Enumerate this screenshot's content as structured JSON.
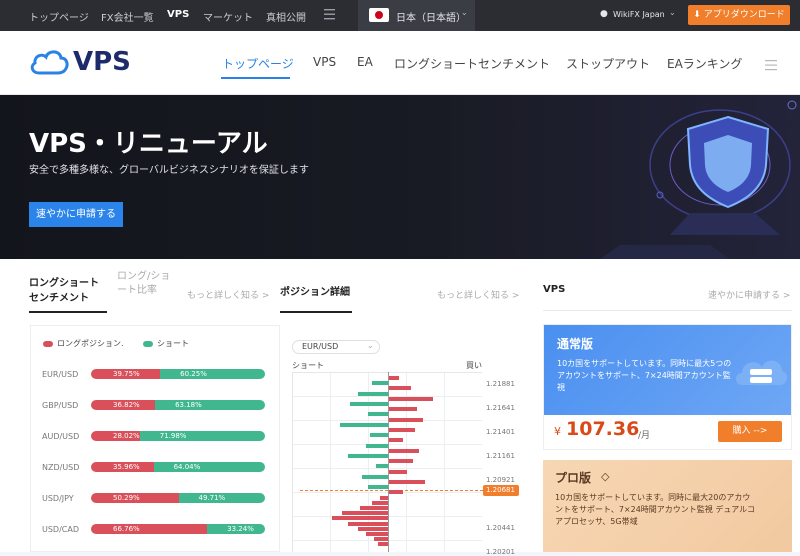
{
  "topbar": {
    "links": [
      "トップページ",
      "FX会社一覧",
      "VPS",
      "マーケット",
      "真相公開"
    ],
    "language": "日本（日本語）",
    "account": "WikiFX Japan",
    "download_label": "アプリダウンロード"
  },
  "nav": {
    "logo": "VPS",
    "items": [
      "トップページ",
      "VPS",
      "EA",
      "ロングショートセンチメント",
      "ストップアウト",
      "EAランキング"
    ]
  },
  "hero": {
    "title": "VPS・リニューアル",
    "subtitle": "安全で多種多様な、グローバルビジネスシナリオを保証します",
    "cta": "速やかに申請する"
  },
  "sentiment": {
    "tab_active": "ロングショートセンチメント",
    "tab_inactive": "ロング/ショート比率",
    "more": "もっと詳しく知る >",
    "legend_long": "ロングポジション.",
    "legend_short": "ショート",
    "rows": [
      {
        "pair": "EUR/USD",
        "long": "39.75%",
        "short": "60.25%"
      },
      {
        "pair": "GBP/USD",
        "long": "36.82%",
        "short": "63.18%"
      },
      {
        "pair": "AUD/USD",
        "long": "28.02%",
        "short": "71.98%"
      },
      {
        "pair": "NZD/USD",
        "long": "35.96%",
        "short": "64.04%"
      },
      {
        "pair": "USD/JPY",
        "long": "50.29%",
        "short": "49.71%"
      },
      {
        "pair": "USD/CAD",
        "long": "66.76%",
        "short": "33.24%"
      }
    ]
  },
  "position": {
    "title": "ポジション詳細",
    "more": "もっと詳しく知る >",
    "select": "EUR/USD",
    "short_label": "ショート",
    "long_label": "買い",
    "prices": [
      "1.21881",
      "1.21641",
      "1.21401",
      "1.21161",
      "1.20921",
      "1.20681",
      "1.20441",
      "1.20201"
    ],
    "current_price": "1.20681"
  },
  "vps": {
    "title": "VPS",
    "more": "速やかに申請する >",
    "plan1_name": "通常版",
    "plan1_desc": "10カ国をサポートしています。同時に最大5つのアカウントをサポート、7×24時間アカウント監視",
    "plan1_currency": "¥",
    "plan1_price": "107.36",
    "plan1_unit": "/月",
    "plan1_button": "購入 -->",
    "plan2_name": "プロ版",
    "plan2_desc": "10カ国をサポートしています。同時に最大20のアカウントをサポート、7×24時間アカウント監視 デュアルコアプロセッサ、5G帯域"
  },
  "colors": {
    "accent": "#2a82e4",
    "long": "#d9505a",
    "short": "#41b78f",
    "orange": "#f07e2b"
  }
}
